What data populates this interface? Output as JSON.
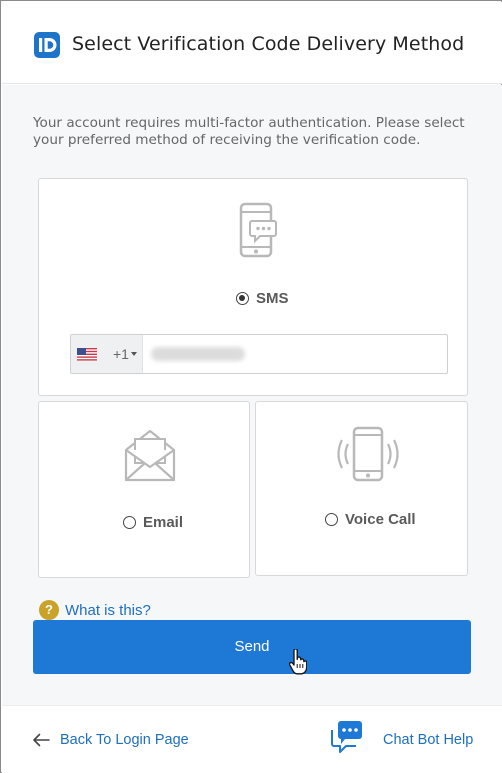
{
  "header": {
    "logo_text": "ID",
    "title": "Select Verification Code Delivery Method"
  },
  "intro": {
    "text": "Your account requires multi-factor authentication. Please select your preferred method of receiving the verification code."
  },
  "methods": {
    "sms": {
      "label": "SMS",
      "selected": true,
      "icon": "phone-message-icon"
    },
    "email": {
      "label": "Email",
      "selected": false,
      "icon": "envelope-icon"
    },
    "voice": {
      "label": "Voice Call",
      "selected": false,
      "icon": "phone-ringing-icon"
    }
  },
  "phone": {
    "country_flag": "us-flag-icon",
    "dial_code": "+1",
    "number_obscured": true
  },
  "help": {
    "badge": "?",
    "link_text": "What is this?"
  },
  "send_button": {
    "label": "Send"
  },
  "footer": {
    "back_link": "Back To Login Page",
    "chat_link": "Chat Bot Help"
  },
  "colors": {
    "primary": "#1e78d6",
    "link": "#1e6fc0",
    "help_badge": "#c9a227",
    "icon_gray": "#b8b8b8"
  }
}
